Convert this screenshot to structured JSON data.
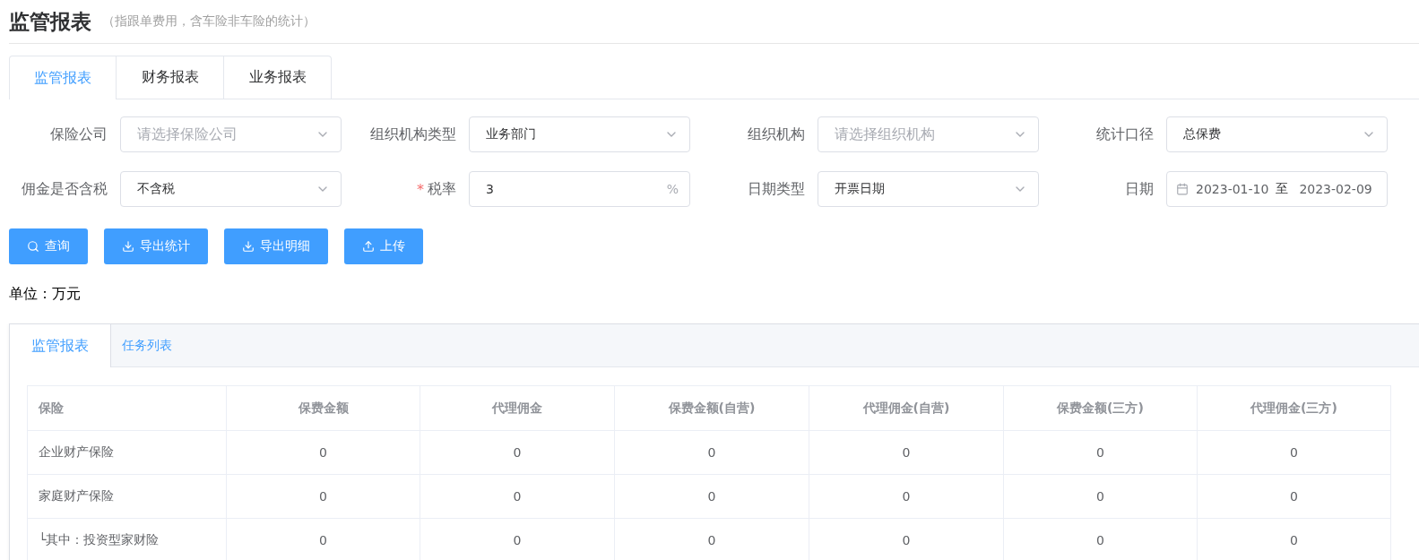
{
  "header": {
    "title": "监管报表",
    "subtitle": "（指跟单费用，含车险非车险的统计）"
  },
  "tabs": [
    {
      "label": "监管报表",
      "selected": true
    },
    {
      "label": "财务报表",
      "selected": false
    },
    {
      "label": "业务报表",
      "selected": false
    }
  ],
  "filters": [
    {
      "label": "保险公司",
      "kind": "select",
      "placeholder": "请选择保险公司"
    },
    {
      "label": "组织机构类型",
      "kind": "select",
      "value": "业务部门"
    },
    {
      "label": "组织机构",
      "kind": "select",
      "placeholder": "请选择组织机构"
    },
    {
      "label": "统计口径",
      "kind": "select",
      "value": "总保费"
    },
    {
      "label": "佣金是否含税",
      "kind": "select",
      "value": "不含税"
    },
    {
      "label": "税率",
      "kind": "input",
      "required": true,
      "required_mark": "*",
      "value": "3",
      "suffix": "%"
    },
    {
      "label": "日期类型",
      "kind": "select",
      "value": "开票日期"
    },
    {
      "label": "日期",
      "kind": "daterange",
      "start": "2023-01-10",
      "separator": "至",
      "end": "2023-02-09"
    }
  ],
  "buttons": [
    {
      "label": "查询",
      "kind": "search"
    },
    {
      "label": "导出统计",
      "kind": "download"
    },
    {
      "label": "导出明细",
      "kind": "download"
    },
    {
      "label": "上传",
      "kind": "upload"
    }
  ],
  "unit": "单位：万元",
  "report_tabs": [
    {
      "label": "监管报表",
      "selected": true
    },
    {
      "label": "任务列表",
      "selected": false
    }
  ],
  "table": {
    "columns": [
      "保险",
      "保费金额",
      "代理佣金",
      "保费金额(自营)",
      "代理佣金(自营)",
      "保费金额(三方)",
      "代理佣金(三方)"
    ],
    "rows": [
      [
        "企业财产保险",
        "0",
        "0",
        "0",
        "0",
        "0",
        "0"
      ],
      [
        "家庭财产保险",
        "0",
        "0",
        "0",
        "0",
        "0",
        "0"
      ],
      [
        "└其中：投资型家财险",
        "0",
        "0",
        "0",
        "0",
        "0",
        "0"
      ]
    ]
  }
}
